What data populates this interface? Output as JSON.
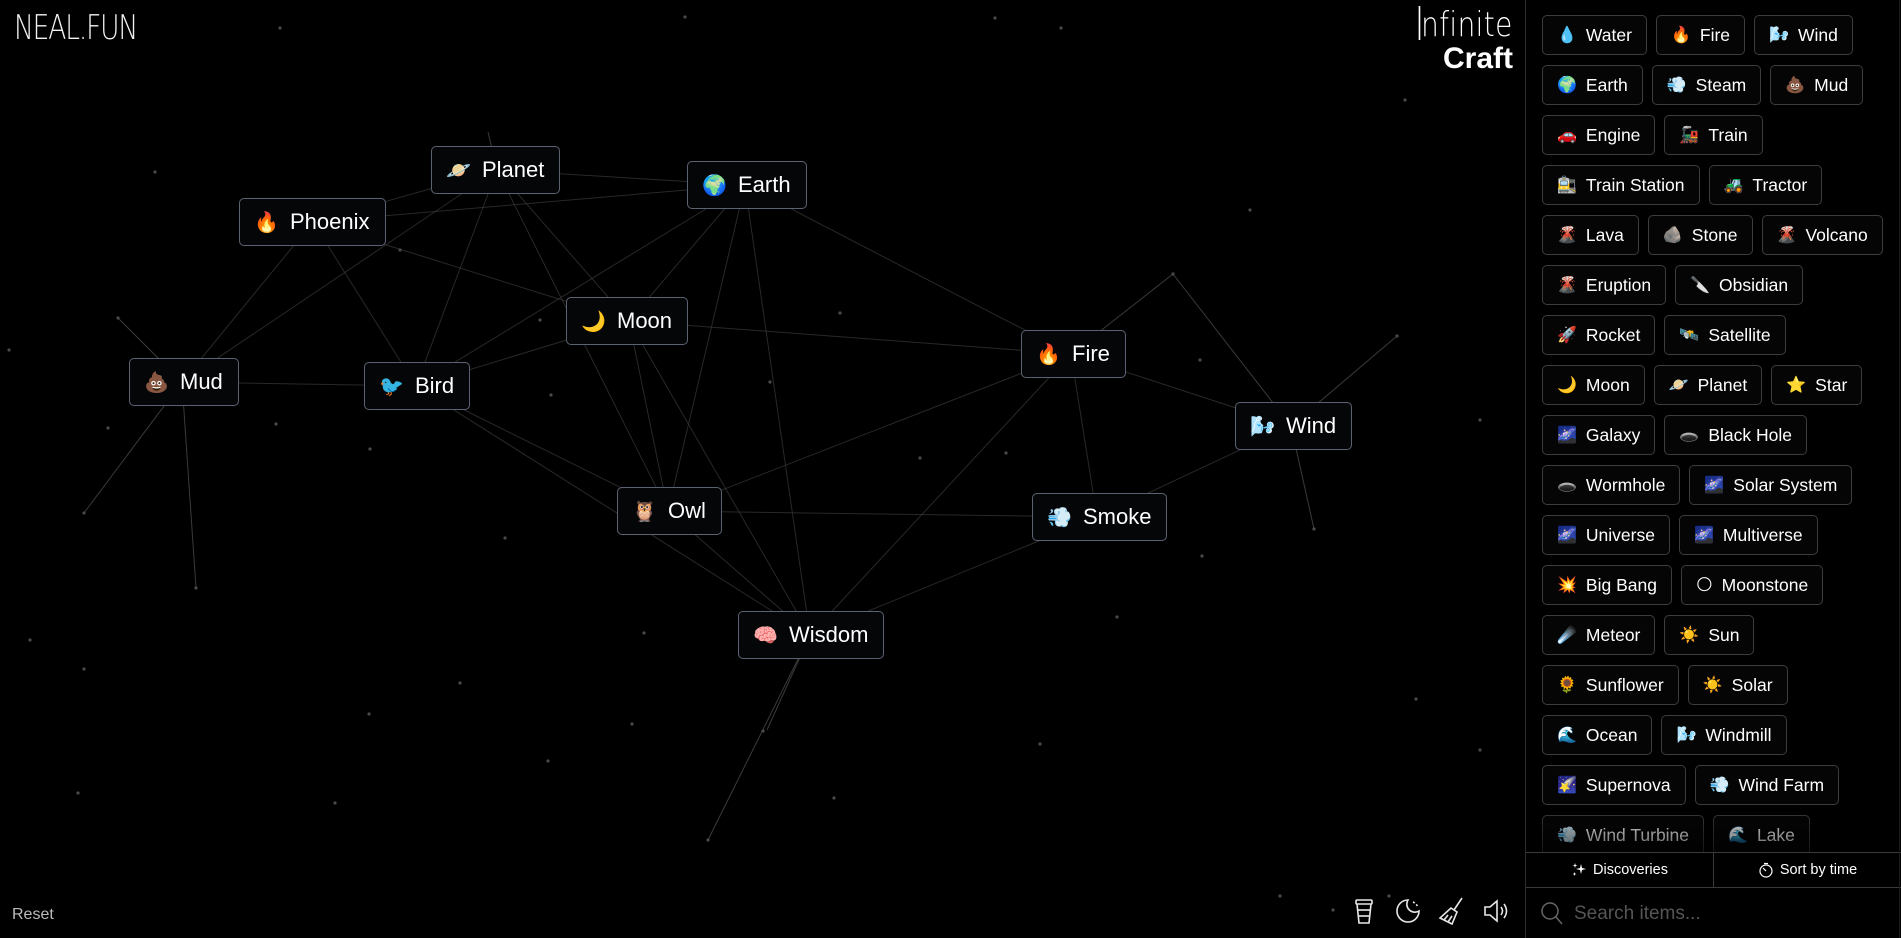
{
  "header": {
    "logo": "NEAL.FUN",
    "title_line1": "nfinite",
    "title_line2": "Craft"
  },
  "canvas": {
    "nodes": [
      {
        "label": "Planet",
        "icon": "planet-icon",
        "emoji": "🪐"
      },
      {
        "label": "Earth",
        "icon": "earth-icon",
        "emoji": "🌍"
      },
      {
        "label": "Phoenix",
        "icon": "fire-icon",
        "emoji": "🔥"
      },
      {
        "label": "Moon",
        "icon": "moon-icon",
        "emoji": "🌙"
      },
      {
        "label": "Mud",
        "icon": "poop-icon",
        "emoji": "💩"
      },
      {
        "label": "Bird",
        "icon": "bird-icon",
        "emoji": "🐦"
      },
      {
        "label": "Fire",
        "icon": "fire-icon",
        "emoji": "🔥"
      },
      {
        "label": "Wind",
        "icon": "wind-face-icon",
        "emoji": "🌬️"
      },
      {
        "label": "Owl",
        "icon": "owl-icon",
        "emoji": "🦉"
      },
      {
        "label": "Smoke",
        "icon": "cloud-puff-icon",
        "emoji": "💨"
      },
      {
        "label": "Wisdom",
        "icon": "brain-icon",
        "emoji": "🧠"
      }
    ]
  },
  "footer": {
    "reset_label": "Reset",
    "tools": [
      {
        "name": "coffee-icon",
        "label": "Support"
      },
      {
        "name": "dark-mode-icon",
        "label": "Theme"
      },
      {
        "name": "broom-icon",
        "label": "Clear"
      },
      {
        "name": "sound-icon",
        "label": "Sound"
      }
    ]
  },
  "sidebar": {
    "items": [
      {
        "label": "Water",
        "emoji": "💧",
        "icon": "droplet-icon"
      },
      {
        "label": "Fire",
        "emoji": "🔥",
        "icon": "fire-icon"
      },
      {
        "label": "Wind",
        "emoji": "🌬️",
        "icon": "wind-face-icon"
      },
      {
        "label": "Earth",
        "emoji": "🌍",
        "icon": "earth-icon"
      },
      {
        "label": "Steam",
        "emoji": "💨",
        "icon": "cloud-puff-icon"
      },
      {
        "label": "Mud",
        "emoji": "💩",
        "icon": "poop-icon"
      },
      {
        "label": "Engine",
        "emoji": "🚗",
        "icon": "car-icon"
      },
      {
        "label": "Train",
        "emoji": "🚂",
        "icon": "locomotive-icon"
      },
      {
        "label": "Train Station",
        "emoji": "🚉",
        "icon": "station-icon"
      },
      {
        "label": "Tractor",
        "emoji": "🚜",
        "icon": "tractor-icon"
      },
      {
        "label": "Lava",
        "emoji": "🌋",
        "icon": "volcano-icon"
      },
      {
        "label": "Stone",
        "emoji": "🪨",
        "icon": "rock-icon"
      },
      {
        "label": "Volcano",
        "emoji": "🌋",
        "icon": "volcano-icon"
      },
      {
        "label": "Eruption",
        "emoji": "🌋",
        "icon": "volcano-icon"
      },
      {
        "label": "Obsidian",
        "emoji": "🔪",
        "icon": "knife-icon"
      },
      {
        "label": "Rocket",
        "emoji": "🚀",
        "icon": "rocket-icon"
      },
      {
        "label": "Satellite",
        "emoji": "🛰️",
        "icon": "satellite-icon"
      },
      {
        "label": "Moon",
        "emoji": "🌙",
        "icon": "moon-icon"
      },
      {
        "label": "Planet",
        "emoji": "🪐",
        "icon": "planet-icon"
      },
      {
        "label": "Star",
        "emoji": "⭐",
        "icon": "star-icon"
      },
      {
        "label": "Galaxy",
        "emoji": "🌌",
        "icon": "milky-way-icon"
      },
      {
        "label": "Black Hole",
        "emoji": "🕳️",
        "icon": "hole-icon"
      },
      {
        "label": "Wormhole",
        "emoji": "🕳️",
        "icon": "hole-icon"
      },
      {
        "label": "Solar System",
        "emoji": "🌌",
        "icon": "milky-way-icon"
      },
      {
        "label": "Universe",
        "emoji": "🌌",
        "icon": "milky-way-icon"
      },
      {
        "label": "Multiverse",
        "emoji": "🌌",
        "icon": "milky-way-icon"
      },
      {
        "label": "Big Bang",
        "emoji": "💥",
        "icon": "explosion-icon"
      },
      {
        "label": "Moonstone",
        "emoji": "🌕",
        "icon": "full-moon-icon"
      },
      {
        "label": "Meteor",
        "emoji": "☄️",
        "icon": "comet-icon"
      },
      {
        "label": "Sun",
        "emoji": "☀️",
        "icon": "sun-icon"
      },
      {
        "label": "Sunflower",
        "emoji": "🌻",
        "icon": "sunflower-icon"
      },
      {
        "label": "Solar",
        "emoji": "☀️",
        "icon": "sun-icon"
      },
      {
        "label": "Ocean",
        "emoji": "🌊",
        "icon": "wave-icon"
      },
      {
        "label": "Windmill",
        "emoji": "🌬️",
        "icon": "wind-face-icon"
      },
      {
        "label": "Supernova",
        "emoji": "🌠",
        "icon": "shooting-star-icon"
      },
      {
        "label": "Wind Farm",
        "emoji": "💨",
        "icon": "cloud-puff-icon"
      },
      {
        "label": "Wind Turbine",
        "emoji": "💨",
        "icon": "cloud-puff-icon"
      },
      {
        "label": "Lake",
        "emoji": "🌊",
        "icon": "wave-icon"
      }
    ],
    "discoveries_label": "Discoveries",
    "sort_label": "Sort by time",
    "search_placeholder": "Search items..."
  },
  "colors": {
    "background": "#000000",
    "node_border": "#5b6372",
    "item_border": "#3d3d3d",
    "line": "#3a3a3a"
  }
}
